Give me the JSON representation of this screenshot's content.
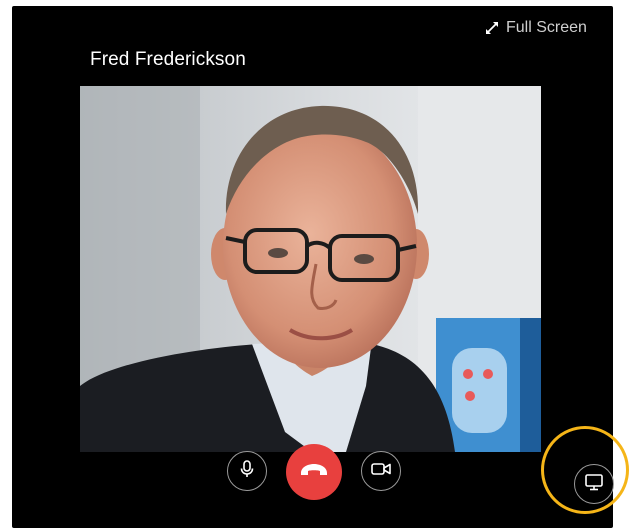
{
  "call": {
    "caller_name": "Fred Frederickson",
    "fullscreen_label": "Full Screen"
  },
  "controls": {
    "mic": "microphone-icon",
    "end_call": "phone-hangup-icon",
    "camera": "video-camera-icon",
    "share_screen": "monitor-icon"
  },
  "colors": {
    "window_bg": "#000000",
    "end_call_red": "#e8403e",
    "highlight_ring": "#f5b518",
    "control_border": "#9a9a9a"
  }
}
